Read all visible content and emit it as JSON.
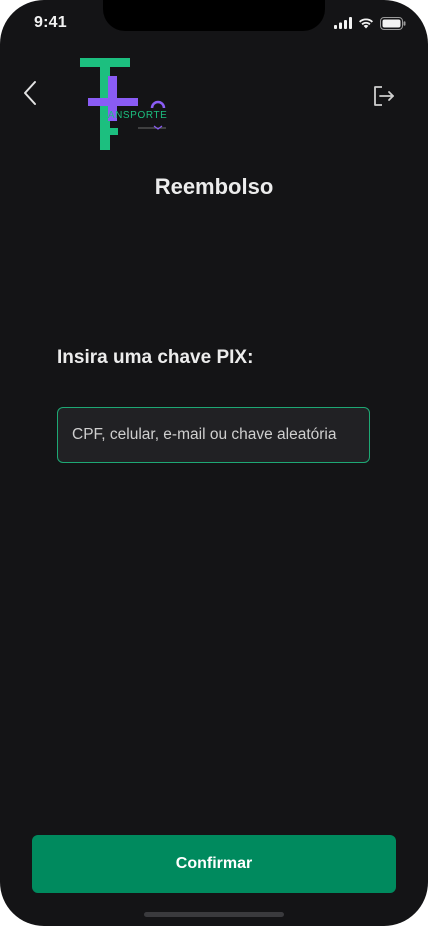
{
  "status_bar": {
    "time": "9:41"
  },
  "header": {
    "logo_text": "RANSPORTE",
    "back_icon": "chevron-left-icon",
    "logout_icon": "logout-icon"
  },
  "page": {
    "title": "Reembolso"
  },
  "form": {
    "label": "Insira uma chave PIX:",
    "placeholder": "CPF, celular, e-mail ou chave aleatória",
    "value": ""
  },
  "actions": {
    "confirm_label": "Confirmar"
  },
  "colors": {
    "background": "#141416",
    "accent_green": "#008a5e",
    "input_border": "#1ea874",
    "logo_green": "#1cbf7f",
    "logo_purple": "#8a5cf5"
  }
}
